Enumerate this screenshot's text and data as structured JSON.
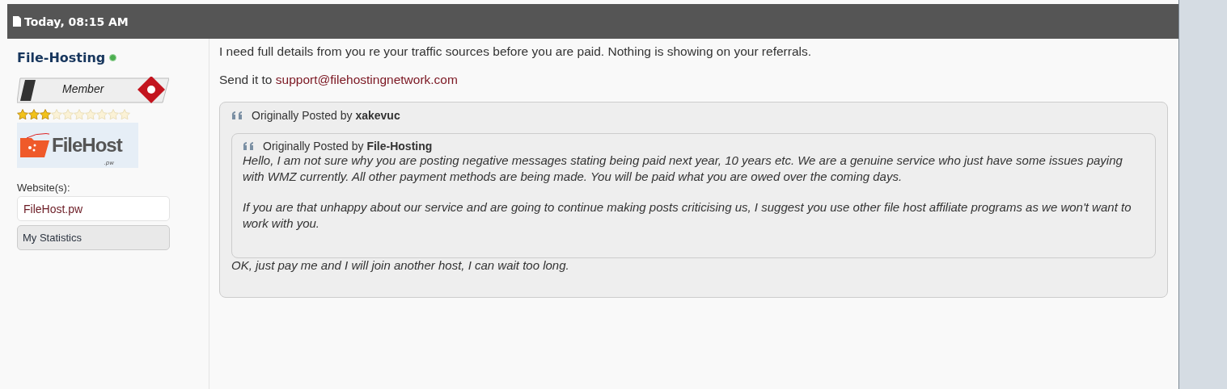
{
  "post_header": {
    "date": "Today, 08:15 AM"
  },
  "user": {
    "name": "File-Hosting",
    "online": true,
    "rank": "Member",
    "stars": 3,
    "logo": {
      "name": "FileHost",
      "suffix": ".pw"
    },
    "websites_label": "Website(s):",
    "website": "FileHost.pw",
    "stats_button": "My Statistics"
  },
  "message": {
    "paragraphs": [
      "I need full details from you re your traffic sources before you are paid. Nothing is showing on your referrals."
    ],
    "send_prefix": "Send it to",
    "email": "support@filehostingnetwork.com"
  },
  "quote": {
    "prefix": "Originally Posted by",
    "author": "xakevuc",
    "inner_quote": {
      "prefix": "Originally Posted by",
      "author": "File-Hosting",
      "paragraphs": [
        "Hello, I am not sure why you are posting negative messages stating being paid next year, 10 years etc. We are a genuine service who just have some issues paying with WMZ currently. All other payment methods are being made. You will be paid what you are owed over the coming days.",
        "If you are that unhappy about our service and are going to continue making posts criticising us, I suggest you use other file host affiliate programs as we won't want to work with you."
      ]
    },
    "reply": "OK, just pay me and I will join another host, I can wait too long."
  }
}
